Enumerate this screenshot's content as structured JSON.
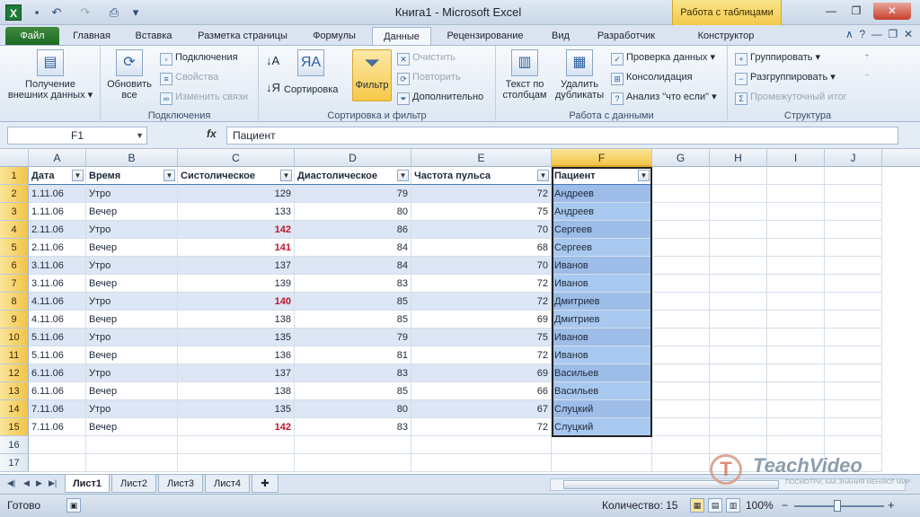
{
  "window": {
    "title": "Книга1 - Microsoft Excel",
    "context_tab": "Работа с таблицами"
  },
  "tabs": [
    {
      "label": "Файл"
    },
    {
      "label": "Главная"
    },
    {
      "label": "Вставка"
    },
    {
      "label": "Разметка страницы"
    },
    {
      "label": "Формулы"
    },
    {
      "label": "Данные"
    },
    {
      "label": "Рецензирование"
    },
    {
      "label": "Вид"
    },
    {
      "label": "Разработчик"
    },
    {
      "label": "Конструктор"
    }
  ],
  "ribbon": {
    "get_external": "Получение внешних данных",
    "refresh_all": "Обновить все",
    "connections": "Подключения",
    "properties": "Свойства",
    "edit_links": "Изменить связи",
    "group_connections": "Подключения",
    "sort": "Сортировка",
    "filter": "Фильтр",
    "clear": "Очистить",
    "reapply": "Повторить",
    "advanced": "Дополнительно",
    "group_sort_filter": "Сортировка и фильтр",
    "text_to_columns": "Текст по столбцам",
    "remove_duplicates": "Удалить дубликаты",
    "data_validation": "Проверка данных",
    "consolidate": "Консолидация",
    "what_if": "Анализ \"что если\"",
    "group_data_tools": "Работа с данными",
    "group": "Группировать",
    "ungroup": "Разгруппировать",
    "subtotal": "Промежуточный итог",
    "group_outline": "Структура"
  },
  "formula_bar": {
    "name_box": "F1",
    "fx": "fx",
    "formula": "Пациент"
  },
  "sheet": {
    "columns": [
      "A",
      "B",
      "C",
      "D",
      "E",
      "F",
      "G",
      "H",
      "I",
      "J"
    ],
    "headers": [
      "Дата",
      "Время",
      "Систолическое",
      "Диастолическое",
      "Частота пульса",
      "Пациент"
    ],
    "rows": [
      [
        "1.11.06",
        "Утро",
        "129",
        "79",
        "72",
        "Андреев"
      ],
      [
        "1.11.06",
        "Вечер",
        "133",
        "80",
        "75",
        "Андреев"
      ],
      [
        "2.11.06",
        "Утро",
        "142",
        "86",
        "70",
        "Сергеев"
      ],
      [
        "2.11.06",
        "Вечер",
        "141",
        "84",
        "68",
        "Сергеев"
      ],
      [
        "3.11.06",
        "Утро",
        "137",
        "84",
        "70",
        "Иванов"
      ],
      [
        "3.11.06",
        "Вечер",
        "139",
        "83",
        "72",
        "Иванов"
      ],
      [
        "4.11.06",
        "Утро",
        "140",
        "85",
        "72",
        "Дмитриев"
      ],
      [
        "4.11.06",
        "Вечер",
        "138",
        "85",
        "69",
        "Дмитриев"
      ],
      [
        "5.11.06",
        "Утро",
        "135",
        "79",
        "75",
        "Иванов"
      ],
      [
        "5.11.06",
        "Вечер",
        "136",
        "81",
        "72",
        "Иванов"
      ],
      [
        "6.11.06",
        "Утро",
        "137",
        "83",
        "69",
        "Васильев"
      ],
      [
        "6.11.06",
        "Вечер",
        "138",
        "85",
        "66",
        "Васильев"
      ],
      [
        "7.11.06",
        "Утро",
        "135",
        "80",
        "67",
        "Слуцкий"
      ],
      [
        "7.11.06",
        "Вечер",
        "142",
        "83",
        "72",
        "Слуцкий"
      ]
    ],
    "highlight_color": "#c0142a",
    "selected_column": "F",
    "selected_row": "1"
  },
  "sheet_tabs": [
    "Лист1",
    "Лист2",
    "Лист3",
    "Лист4"
  ],
  "status": {
    "ready": "Готово",
    "count": "Количество: 15",
    "zoom": "100%"
  },
  "watermark": {
    "brand": "TeachVideo",
    "tagline": "ПОСМОТРИ, КАК ЗНАНИЯ МЕНЯЮТ МИР"
  }
}
